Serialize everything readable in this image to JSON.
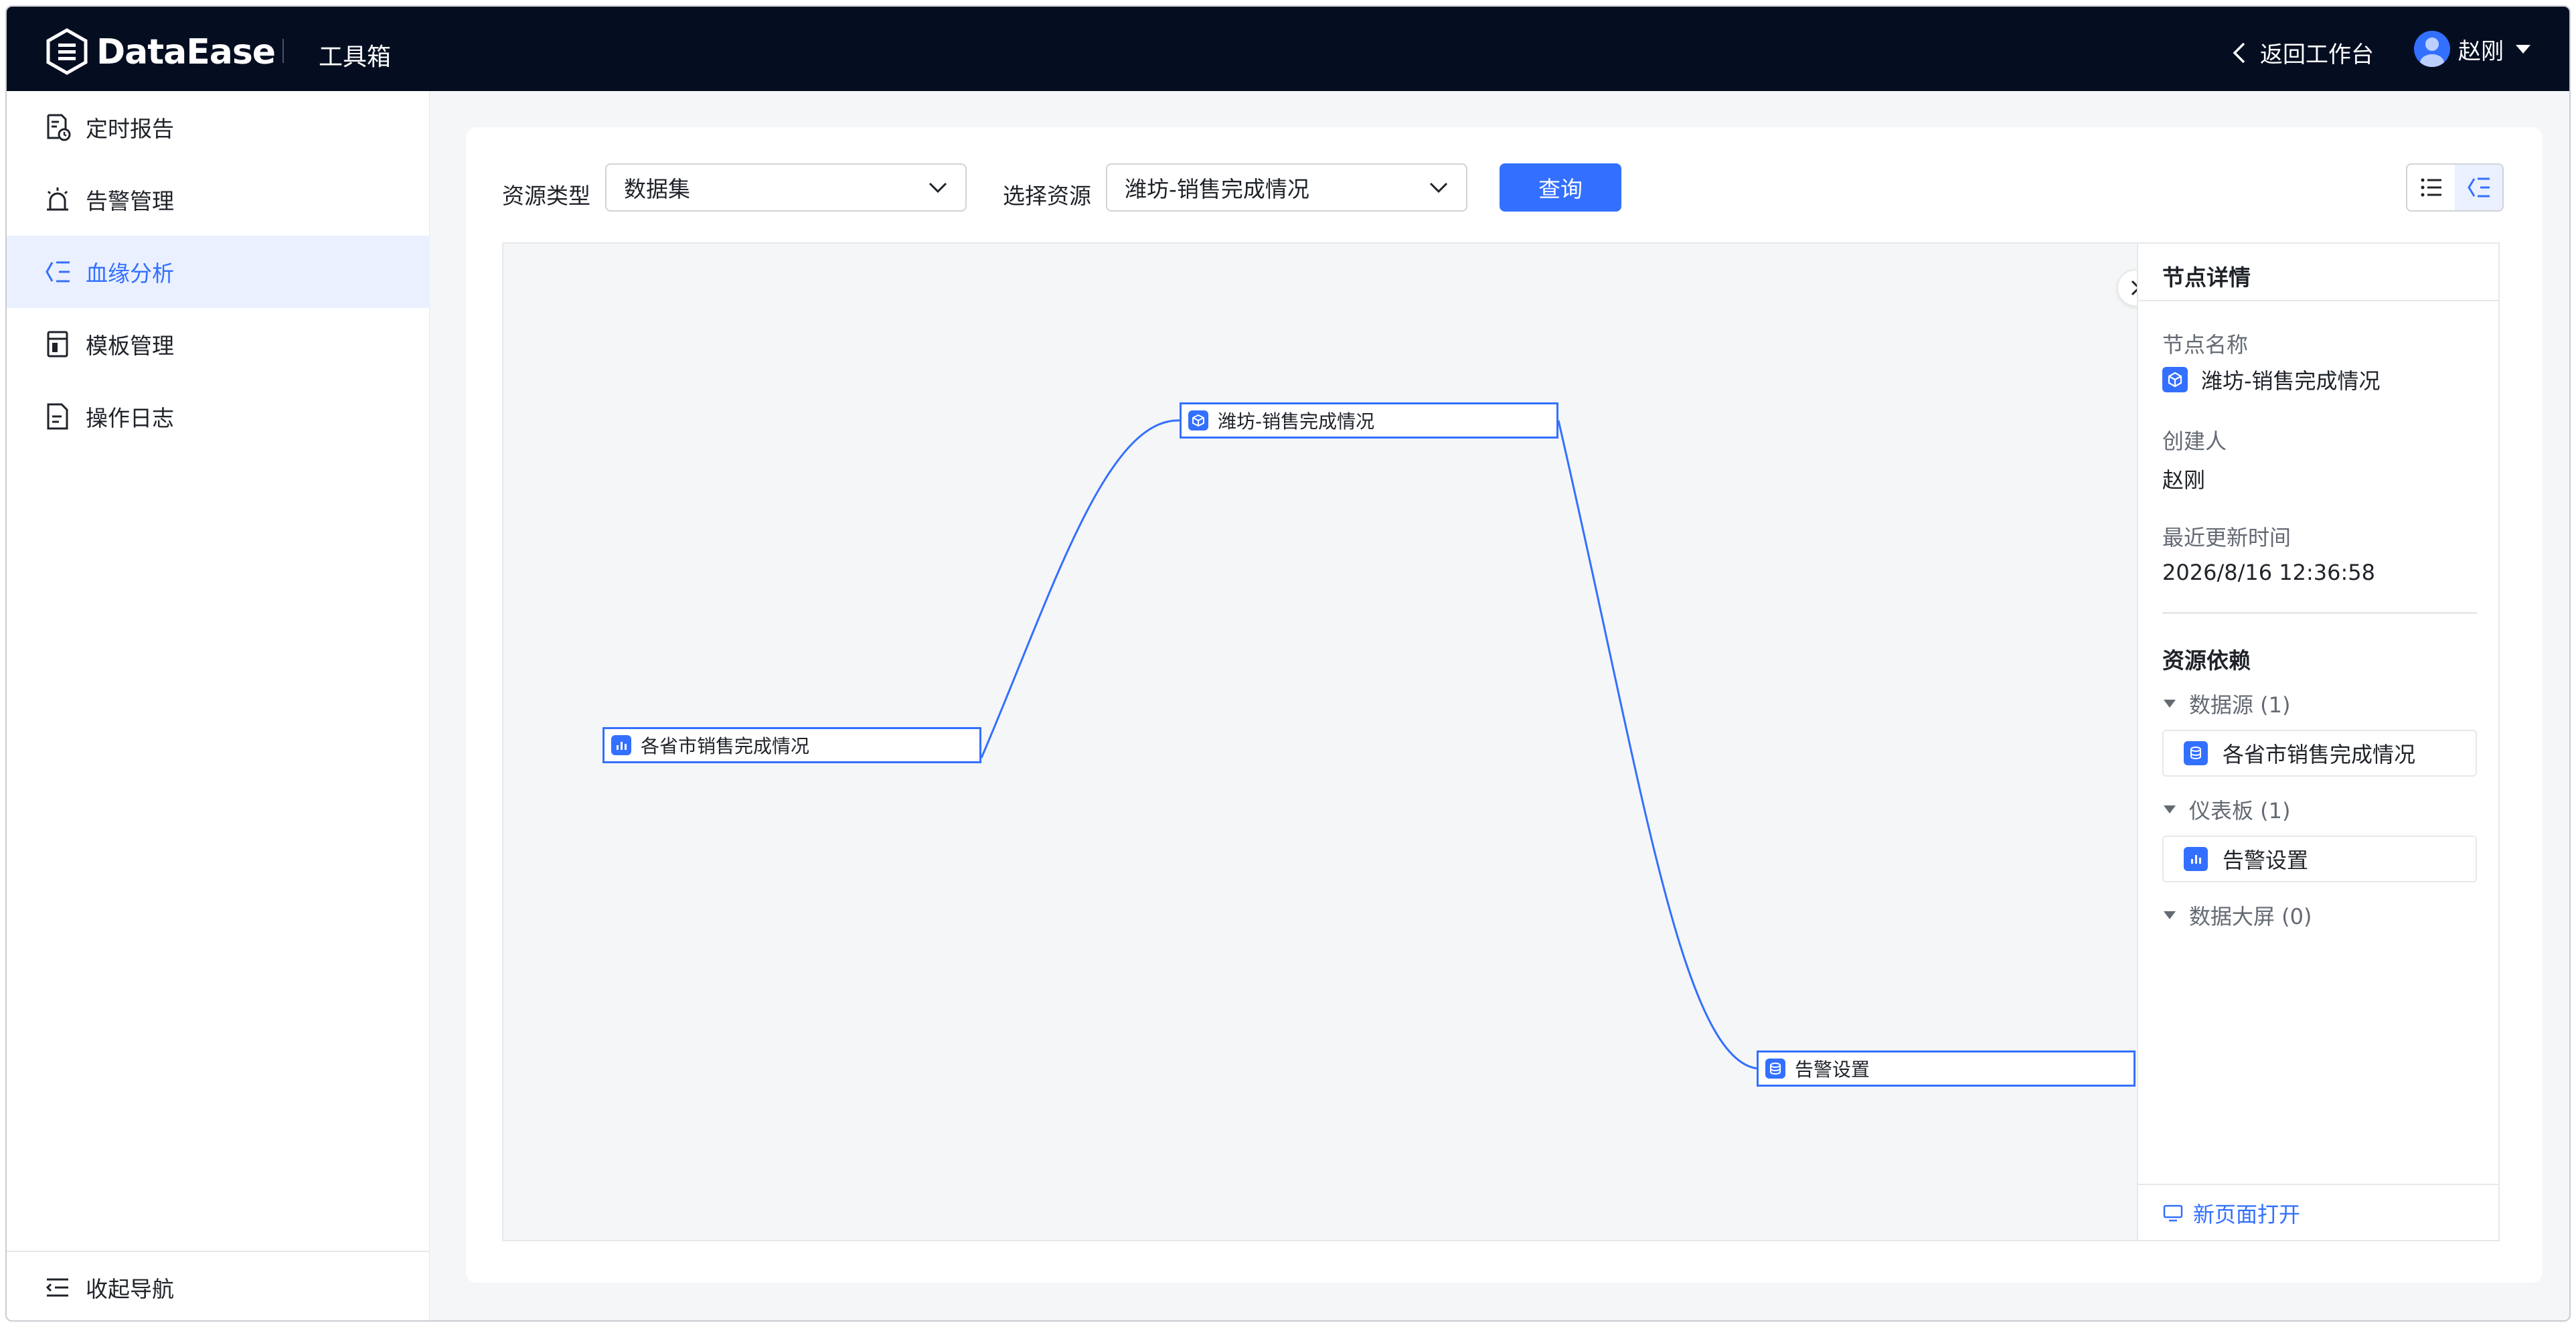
{
  "header": {
    "brand": "DataEase",
    "section_title": "工具箱",
    "back_label": "返回工作台",
    "user_name": "赵刚"
  },
  "sidebar": {
    "items": [
      {
        "label": "定时报告",
        "icon": "report-clock-icon",
        "active": false
      },
      {
        "label": "告警管理",
        "icon": "alarm-icon",
        "active": false
      },
      {
        "label": "血缘分析",
        "icon": "lineage-icon",
        "active": true
      },
      {
        "label": "模板管理",
        "icon": "template-icon",
        "active": false
      },
      {
        "label": "操作日志",
        "icon": "log-icon",
        "active": false
      }
    ],
    "collapse_label": "收起导航"
  },
  "filters": {
    "resource_type_label": "资源类型",
    "resource_type_value": "数据集",
    "resource_select_label": "选择资源",
    "resource_select_value": "潍坊-销售完成情况",
    "query_label": "查询"
  },
  "graph": {
    "nodes": [
      {
        "id": "source",
        "label": "各省市销售完成情况",
        "icon": "chart-icon"
      },
      {
        "id": "dataset",
        "label": "潍坊-销售完成情况",
        "icon": "cube-icon"
      },
      {
        "id": "dashboard",
        "label": "告警设置",
        "icon": "database-icon"
      }
    ]
  },
  "detail": {
    "title": "节点详情",
    "name_label": "节点名称",
    "name_value": "潍坊-销售完成情况",
    "creator_label": "创建人",
    "creator_value": "赵刚",
    "updated_label": "最近更新时间",
    "updated_value": "2026/8/16 12:36:58",
    "deps_title": "资源依赖",
    "groups": [
      {
        "label": "数据源 (1)",
        "items": [
          "各省市销售完成情况"
        ]
      },
      {
        "label": "仪表板 (1)",
        "items": [
          "告警设置"
        ]
      },
      {
        "label": "数据大屏 (0)",
        "items": []
      }
    ],
    "open_new_page": "新页面打开"
  },
  "colors": {
    "accent": "#3370ff",
    "header_bg": "#050e21",
    "active_bg": "#eaf0ff"
  }
}
